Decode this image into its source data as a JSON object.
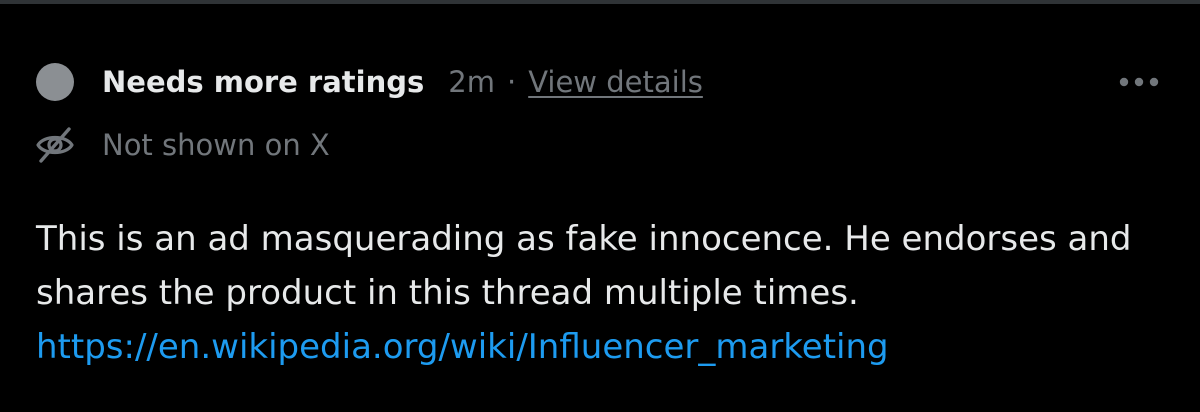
{
  "note": {
    "status_title": "Needs more ratings",
    "timestamp": "2m",
    "separator": "·",
    "details_link": "View details",
    "visibility_label": "Not shown on X",
    "body_text": "This is an ad masquerading as fake innocence. He endorses and shares the product in this thread multiple times. ",
    "body_link": "https://en.wikipedia.org/wiki/Influencer_marketing"
  },
  "icons": {
    "status": "status-dot-icon",
    "visibility": "eye-off-icon",
    "more": "more-horizontal-icon"
  },
  "colors": {
    "background": "#000000",
    "primary_text": "#e7e9ea",
    "secondary_text": "#71767b",
    "status_dot": "#8b8f93",
    "link": "#1d9bf0",
    "divider": "#2f3336"
  }
}
